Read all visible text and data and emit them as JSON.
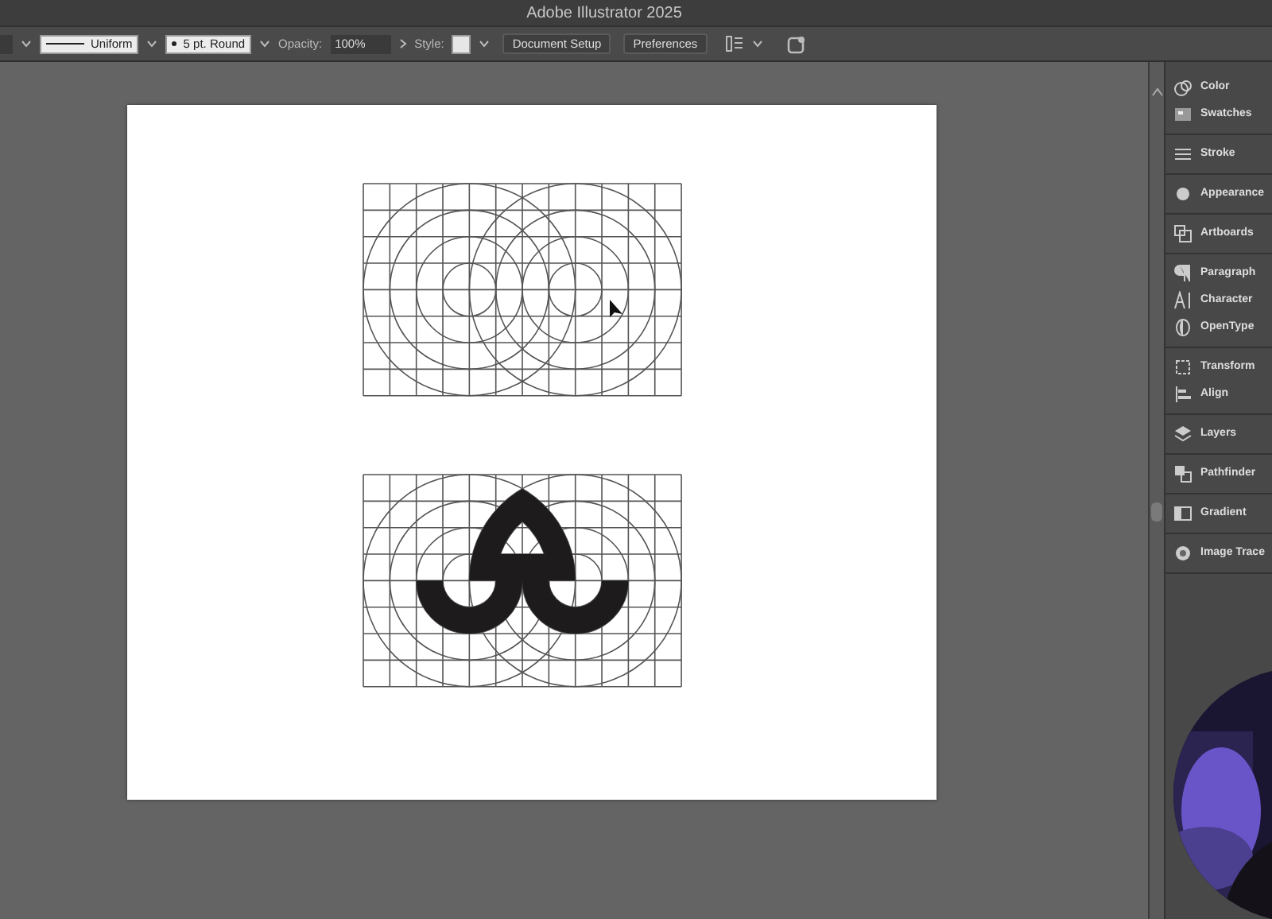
{
  "window": {
    "title": "Adobe Illustrator 2025"
  },
  "control_bar": {
    "stroke_profile": "Uniform",
    "brush": "5 pt. Round",
    "opacity_label": "Opacity:",
    "opacity": "100%",
    "style_label": "Style:",
    "buttons": [
      "Document Setup",
      "Preferences"
    ]
  },
  "panels": [
    {
      "items": [
        "Color",
        "Swatches"
      ]
    },
    {
      "items": [
        "Stroke"
      ]
    },
    {
      "items": [
        "Appearance"
      ]
    },
    {
      "items": [
        "Artboards"
      ]
    },
    {
      "items": [
        "Paragraph",
        "Character",
        "OpenType"
      ]
    },
    {
      "items": [
        "Transform",
        "Align"
      ]
    },
    {
      "items": [
        "Layers"
      ]
    },
    {
      "items": [
        "Pathfinder"
      ]
    },
    {
      "items": [
        "Gradient"
      ]
    },
    {
      "items": [
        "Image Trace"
      ]
    }
  ],
  "artboard": {
    "grids": [
      {
        "kind": "empty"
      },
      {
        "kind": "glyph"
      }
    ]
  }
}
